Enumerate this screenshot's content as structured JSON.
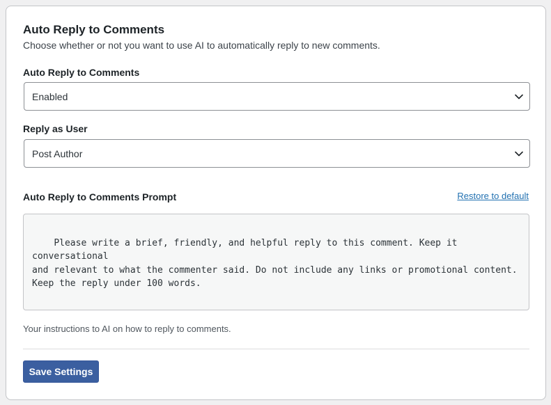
{
  "section": {
    "title": "Auto Reply to Comments",
    "description": "Choose whether or not you want to use AI to automatically reply to new comments."
  },
  "auto_reply": {
    "label": "Auto Reply to Comments",
    "selected": "Enabled",
    "icon": "chevron-down-icon"
  },
  "reply_as_user": {
    "label": "Reply as User",
    "selected": "Post Author",
    "icon": "chevron-down-icon"
  },
  "prompt": {
    "label": "Auto Reply to Comments Prompt",
    "restore_label": "Restore to default",
    "value": "Please write a brief, friendly, and helpful reply to this comment. Keep it conversational\nand relevant to what the commenter said. Do not include any links or promotional content.\nKeep the reply under 100 words.",
    "help": "Your instructions to AI on how to reply to comments."
  },
  "actions": {
    "save_label": "Save Settings"
  },
  "colors": {
    "primary_button": "#3b5fa0",
    "link": "#2271b1",
    "textarea_bg": "#f6f7f7"
  }
}
